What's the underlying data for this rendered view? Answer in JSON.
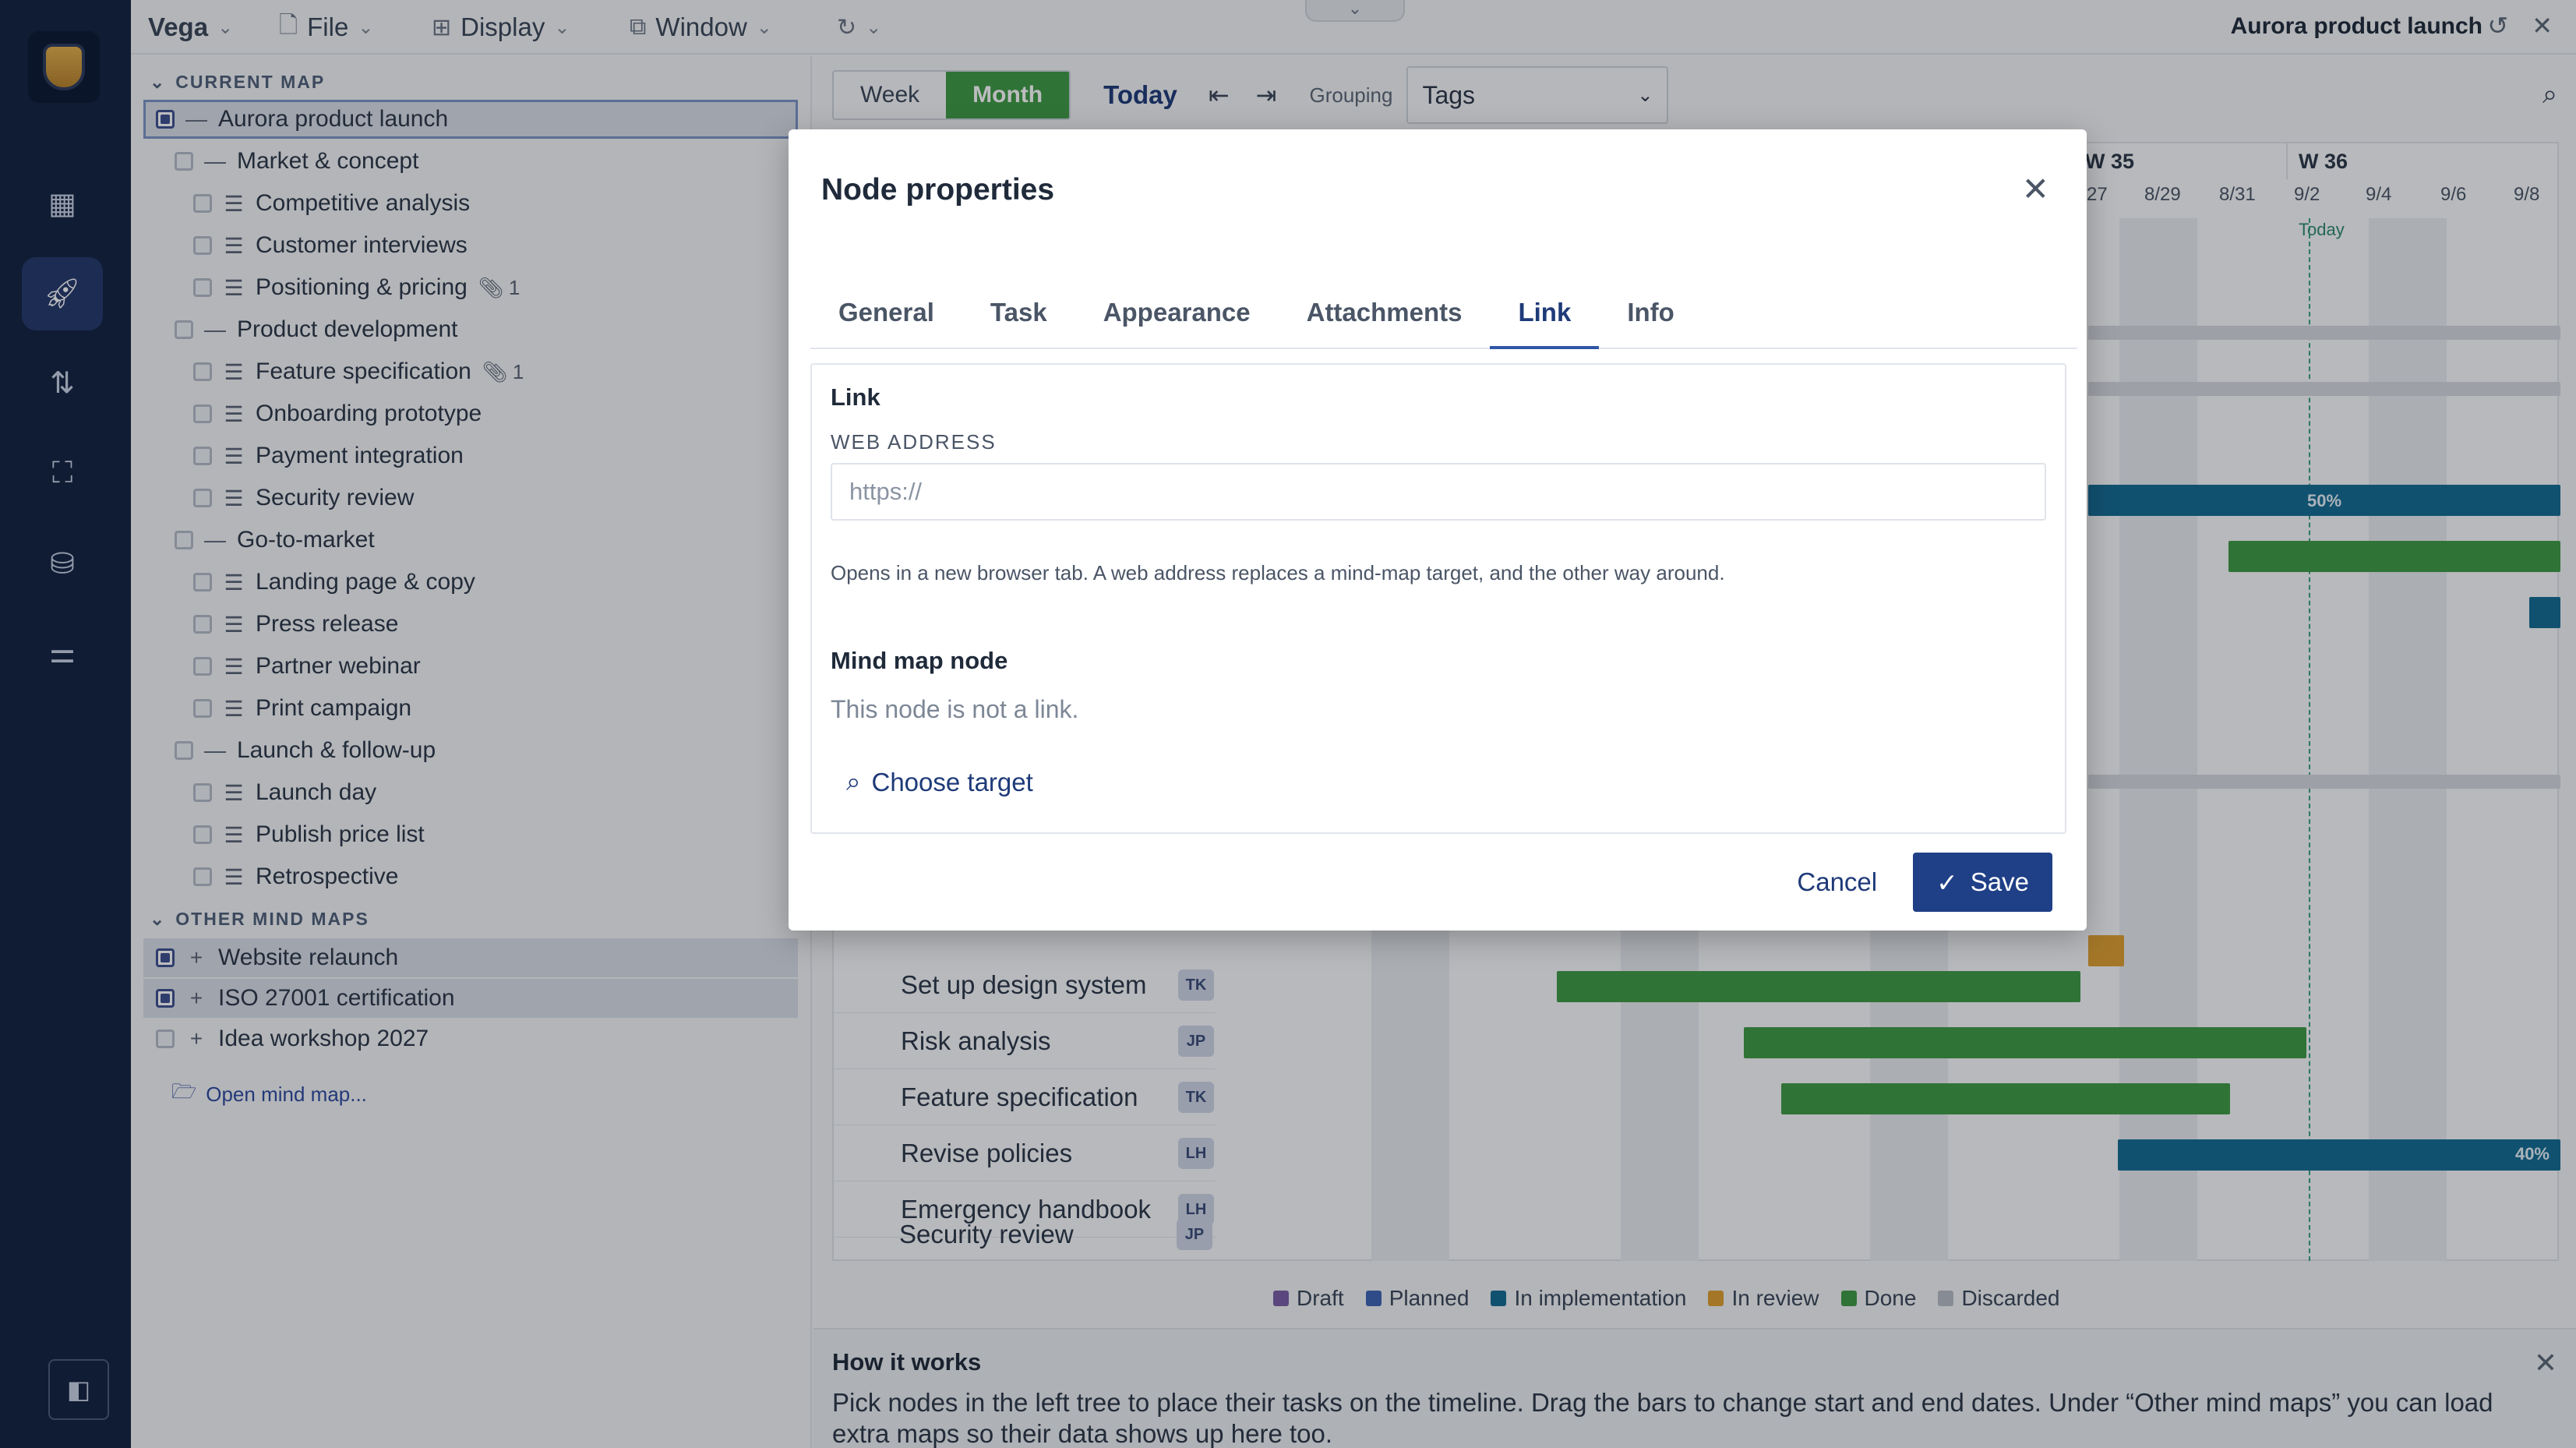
{
  "toolbar": {
    "app_menu": "Vega",
    "file": "File",
    "display": "Display",
    "window": "Window",
    "doc_title": "Aurora product launch"
  },
  "tree": {
    "current_section": "CURRENT MAP",
    "other_section": "OTHER MIND MAPS",
    "other_count": "3",
    "root": "Aurora product launch",
    "groups": [
      {
        "label": "Market & concept",
        "items": [
          {
            "label": "Competitive analysis",
            "attach": ""
          },
          {
            "label": "Customer interviews",
            "attach": ""
          },
          {
            "label": "Positioning & pricing",
            "attach": "1"
          }
        ]
      },
      {
        "label": "Product development",
        "items": [
          {
            "label": "Feature specification",
            "attach": "1"
          },
          {
            "label": "Onboarding prototype",
            "attach": ""
          },
          {
            "label": "Payment integration",
            "attach": ""
          },
          {
            "label": "Security review",
            "attach": ""
          }
        ]
      },
      {
        "label": "Go-to-market",
        "items": [
          {
            "label": "Landing page & copy",
            "attach": ""
          },
          {
            "label": "Press release",
            "attach": ""
          },
          {
            "label": "Partner webinar",
            "attach": ""
          },
          {
            "label": "Print campaign",
            "attach": ""
          }
        ]
      },
      {
        "label": "Launch & follow-up",
        "items": [
          {
            "label": "Launch day",
            "attach": ""
          },
          {
            "label": "Publish price list",
            "attach": ""
          },
          {
            "label": "Retrospective",
            "attach": ""
          }
        ]
      }
    ],
    "other_maps": [
      "Website relaunch",
      "ISO 27001 certification",
      "Idea workshop 2027"
    ],
    "open_map": "Open mind map..."
  },
  "gantt": {
    "week": "Week",
    "month": "Month",
    "today": "Today",
    "grouping_label": "Grouping",
    "grouping_value": "Tags",
    "weeks": [
      "W 35",
      "W 36"
    ],
    "days": [
      "8/27",
      "8/29",
      "8/31",
      "9/2",
      "9/4",
      "9/6",
      "9/8"
    ],
    "today_marker": "Today",
    "bar_labels": [
      "50%",
      "40%"
    ],
    "rows": [
      {
        "name": "Set up design system",
        "who": "TK"
      },
      {
        "name": "Risk analysis",
        "who": "JP"
      },
      {
        "name": "Feature specification",
        "who": "TK"
      },
      {
        "name": "Revise policies",
        "who": "LH"
      },
      {
        "name": "Emergency handbook",
        "who": "LH"
      },
      {
        "name": "Security review",
        "who": "JP"
      }
    ],
    "legend": [
      {
        "label": "Draft",
        "color": "#7b5ea7"
      },
      {
        "label": "Planned",
        "color": "#3e63b5"
      },
      {
        "label": "In implementation",
        "color": "#146b93"
      },
      {
        "label": "In review",
        "color": "#e0a030"
      },
      {
        "label": "Done",
        "color": "#3f9a45"
      },
      {
        "label": "Discarded",
        "color": "#b8bcc4"
      }
    ]
  },
  "how": {
    "title": "How it works",
    "text": "Pick nodes in the left tree to place their tasks on the timeline. Drag the bars to change start and end dates. Under “Other mind maps” you can load extra maps so their data shows up here too."
  },
  "modal": {
    "title": "Node properties",
    "tabs": [
      "General",
      "Task",
      "Appearance",
      "Attachments",
      "Link",
      "Info"
    ],
    "active_tab": "Link",
    "link_heading": "Link",
    "web_label": "WEB ADDRESS",
    "web_placeholder": "https://",
    "web_value": "",
    "help": "Opens in a new browser tab. A web address replaces a mind-map target, and the other way around.",
    "node_heading": "Mind map node",
    "node_empty": "This node is not a link.",
    "choose_target": "Choose target",
    "cancel": "Cancel",
    "save": "Save"
  },
  "colors": {
    "rail": "#13223f",
    "accent": "#1f3f86",
    "done": "#3f9a45",
    "implementation": "#146b93"
  }
}
